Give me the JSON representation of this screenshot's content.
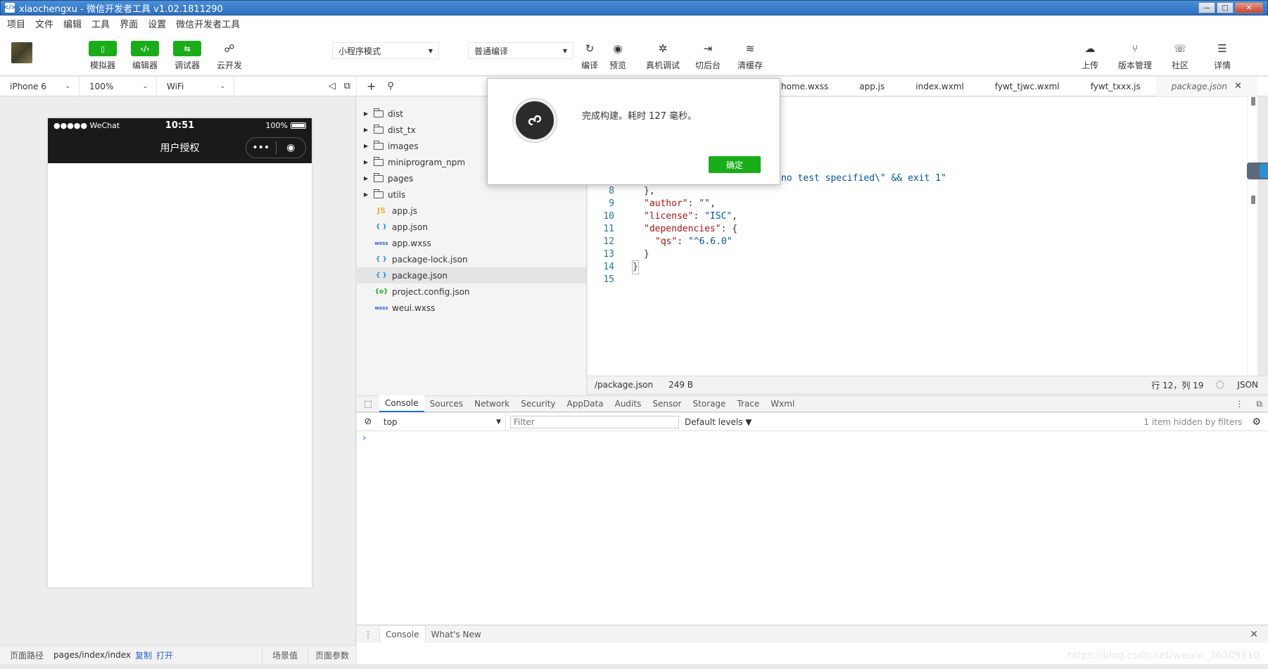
{
  "window": {
    "title": "xiaochengxu - 微信开发者工具 v1.02.1811290",
    "icon": "</>",
    "min": "—",
    "max": "□",
    "close": "✕"
  },
  "menu": [
    "项目",
    "文件",
    "编辑",
    "工具",
    "界面",
    "设置",
    "微信开发者工具"
  ],
  "toolbar": {
    "simulator": "模拟器",
    "editor": "编辑器",
    "debugger": "调试器",
    "cloud": "云开发",
    "mode_select": "小程序模式",
    "compile_select": "普通编译",
    "compile": "编译",
    "preview": "预览",
    "remote_debug": "真机调试",
    "background": "切后台",
    "clear_cache": "清缓存",
    "upload": "上传",
    "version": "版本管理",
    "community": "社区",
    "details": "详情"
  },
  "simulator": {
    "device": "iPhone 6",
    "zoom": "100%",
    "network": "WiFi",
    "status_left": "●●●●● WeChat",
    "status_time": "10:51",
    "status_battery": "100%",
    "nav_title": "用户授权",
    "capsule_more": "•••",
    "capsule_close": "◉"
  },
  "explorer": {
    "folders": [
      "dist",
      "dist_tx",
      "images",
      "miniprogram_npm",
      "pages",
      "utils"
    ],
    "files": [
      {
        "name": "app.js",
        "icon": "JS"
      },
      {
        "name": "app.json",
        "icon": "{ }"
      },
      {
        "name": "app.wxss",
        "icon": "wxss"
      },
      {
        "name": "package-lock.json",
        "icon": "{ }"
      },
      {
        "name": "package.json",
        "icon": "{ }"
      },
      {
        "name": "project.config.json",
        "icon": "{o}"
      },
      {
        "name": "weui.wxss",
        "icon": "wxss"
      }
    ]
  },
  "tabs": [
    "home.wxss",
    "app.js",
    "index.wxml",
    "fywt_tjwc.wxml",
    "fywt_txxx.js",
    "package.json"
  ],
  "editor": {
    "partial_line": "no test specified\\\" && exit 1\"",
    "lines": [
      {
        "n": "8",
        "text": "},"
      },
      {
        "n": "9",
        "key": "\"author\"",
        "rest": ": ",
        "val": "\"\"",
        "tail": ","
      },
      {
        "n": "10",
        "key": "\"license\"",
        "rest": ": ",
        "val": "\"ISC\"",
        "tail": ","
      },
      {
        "n": "11",
        "key": "\"dependencies\"",
        "rest": ": {",
        "val": "",
        "tail": ""
      },
      {
        "n": "12",
        "key": "\"qs\"",
        "rest": ": ",
        "val": "\"^6.6.0\"",
        "tail": ""
      },
      {
        "n": "13",
        "text": "}"
      },
      {
        "n": "14",
        "text": "}"
      },
      {
        "n": "15",
        "text": ""
      }
    ]
  },
  "status": {
    "path": "/package.json",
    "size": "249 B",
    "cursor": "行 12，列 19",
    "lang": "JSON"
  },
  "devtools": {
    "tabs": [
      "Console",
      "Sources",
      "Network",
      "Security",
      "AppData",
      "Audits",
      "Sensor",
      "Storage",
      "Trace",
      "Wxml"
    ],
    "context": "top",
    "filter_placeholder": "Filter",
    "levels": "Default levels ▼",
    "hidden": "1 item hidden by filters",
    "prompt": "›",
    "drawer_tabs": [
      "Console",
      "What's New"
    ]
  },
  "bottom": {
    "path_label": "页面路径",
    "path": "pages/index/index",
    "copy": "复制",
    "open": "打开",
    "scene": "场景值",
    "params": "页面参数"
  },
  "dialog": {
    "message": "完成构建。耗时 127 毫秒。",
    "ok": "确定"
  },
  "watermark": "https://blog.csdn.net/weixin_36309910"
}
